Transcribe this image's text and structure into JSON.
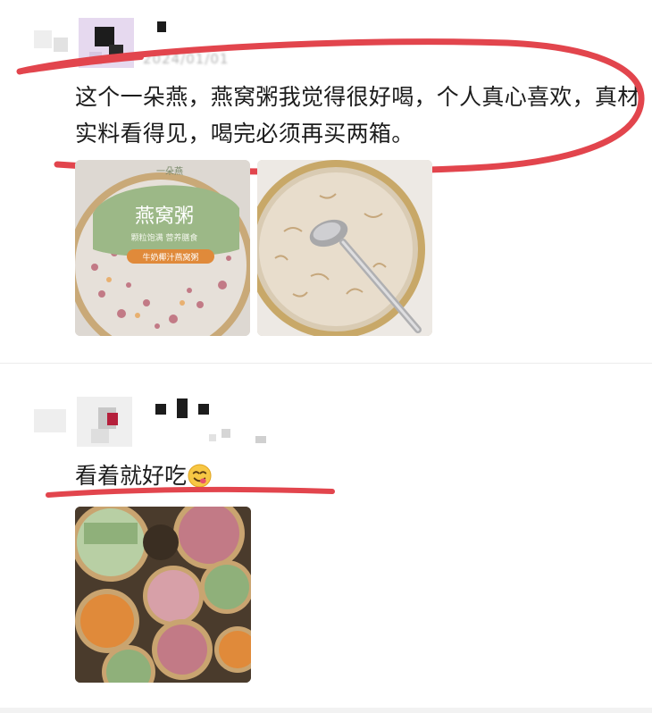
{
  "comments": [
    {
      "date": "2024/01/01",
      "text": "这个一朵燕，燕窝粥我觉得很好喝，个人真心喜欢，真材实料看得见，喝完必须再买两箱。",
      "photos": [
        {
          "label_top": "一朵燕",
          "title": "燕窝粥",
          "subtitle": "颗粒饱满 营养膳食",
          "flavor": "牛奶椰汁燕窝粥"
        },
        {
          "description": "spoon-in-can"
        }
      ]
    },
    {
      "text": "看着就好吃",
      "emoji": "yum-face-emoji",
      "photos": [
        {
          "description": "stack-of-cans"
        }
      ]
    }
  ],
  "colors": {
    "annotation_red": "#e2454d",
    "label_green": "#8fb07a",
    "label_orange": "#e08a3a"
  }
}
